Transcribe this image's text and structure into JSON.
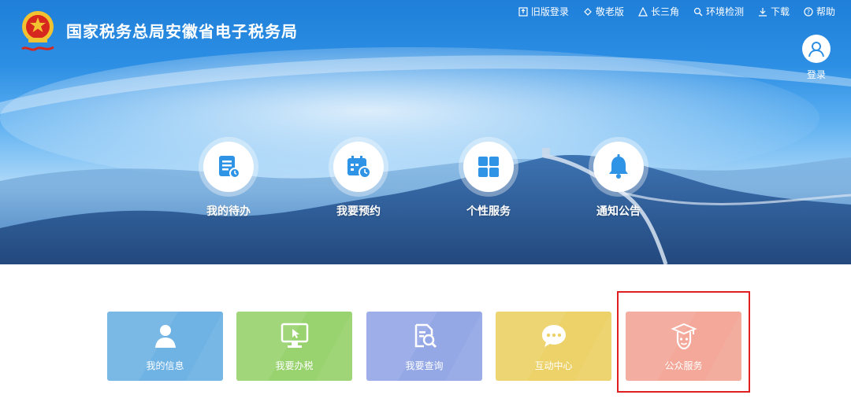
{
  "site": {
    "title": "国家税务总局安徽省电子税务局"
  },
  "topnav": [
    {
      "label": "旧版登录",
      "icon": "old-version-icon"
    },
    {
      "label": "敬老版",
      "icon": "elderly-version-icon"
    },
    {
      "label": "长三角",
      "icon": "yangtze-delta-icon"
    },
    {
      "label": "环境检测",
      "icon": "environment-check-icon"
    },
    {
      "label": "下载",
      "icon": "download-icon"
    },
    {
      "label": "帮助",
      "icon": "help-icon"
    }
  ],
  "login": {
    "label": "登录",
    "icon": "user-icon"
  },
  "quick_links": [
    {
      "label": "我的待办",
      "icon": "todo-list-icon"
    },
    {
      "label": "我要预约",
      "icon": "calendar-clock-icon"
    },
    {
      "label": "个性服务",
      "icon": "grid-icon"
    },
    {
      "label": "通知公告",
      "icon": "bell-icon"
    }
  ],
  "tiles": [
    {
      "label": "我的信息",
      "icon": "person-icon",
      "color": "#6fb3e4"
    },
    {
      "label": "我要办税",
      "icon": "monitor-cursor-icon",
      "color": "#99d36f"
    },
    {
      "label": "我要查询",
      "icon": "document-search-icon",
      "color": "#95a8e6"
    },
    {
      "label": "互动中心",
      "icon": "chat-bubble-icon",
      "color": "#ecd268"
    },
    {
      "label": "公众服务",
      "icon": "graduate-icon",
      "color": "#f3a899"
    }
  ],
  "colors": {
    "highlight_border": "#e02020",
    "hero_primary": "#2d8fe4",
    "quick_icon": "#2f93e6"
  }
}
